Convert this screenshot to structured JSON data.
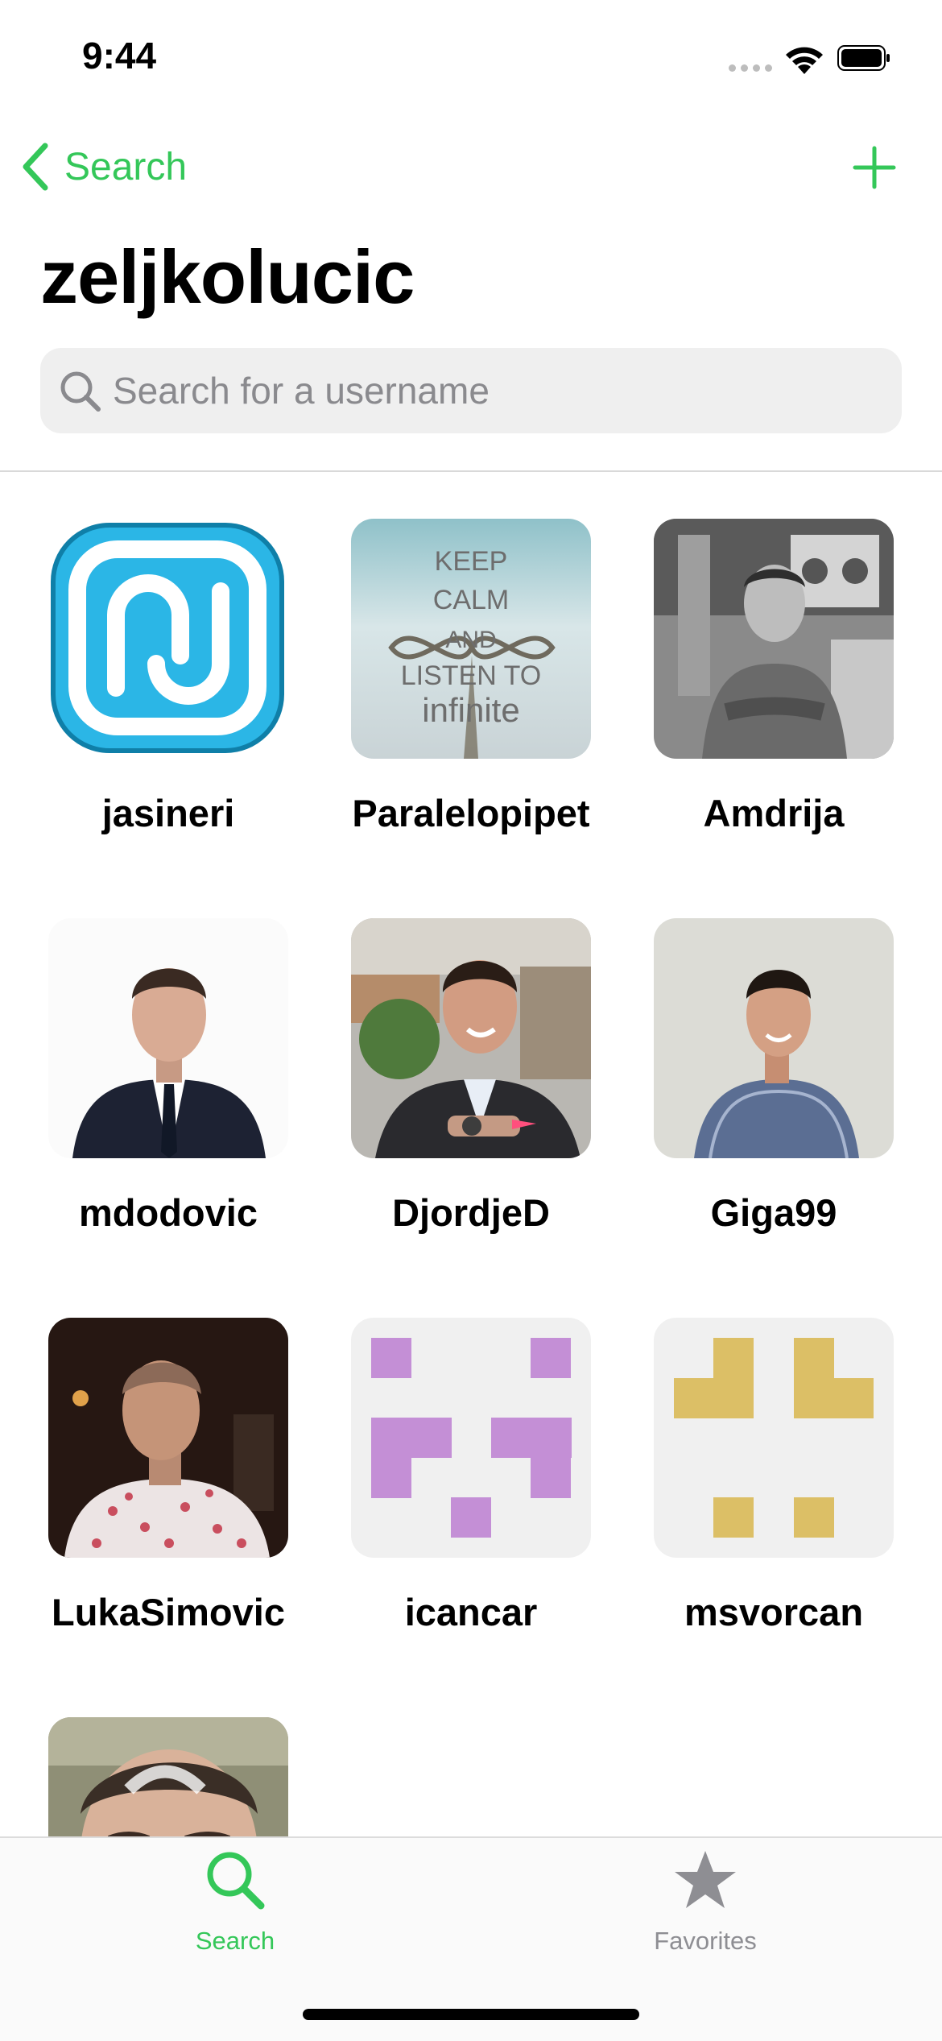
{
  "status_bar": {
    "time": "9:44"
  },
  "nav": {
    "back_label": "Search",
    "title": "zeljkolucic"
  },
  "search": {
    "placeholder": "Search for a username",
    "value": ""
  },
  "users": [
    {
      "username": "jasineri"
    },
    {
      "username": "Paralelopipet"
    },
    {
      "username": "Amdrija"
    },
    {
      "username": "mdodovic"
    },
    {
      "username": "DjordjeD"
    },
    {
      "username": "Giga99"
    },
    {
      "username": "LukaSimovic"
    },
    {
      "username": "icancar"
    },
    {
      "username": "msvorcan"
    },
    {
      "username": ""
    }
  ],
  "avatar_text": {
    "paralelopipet": [
      "KEEP",
      "CALM",
      "AND",
      "LISTEN TO",
      "infinite"
    ]
  },
  "tabs": [
    {
      "label": "Search",
      "icon": "search-icon",
      "selected": true
    },
    {
      "label": "Favorites",
      "icon": "star-icon",
      "selected": false
    }
  ],
  "colors": {
    "accent": "#34c759",
    "inactive": "#8e8e93",
    "identicon_purple": "#c48fd6",
    "identicon_gold": "#dcbf66"
  }
}
